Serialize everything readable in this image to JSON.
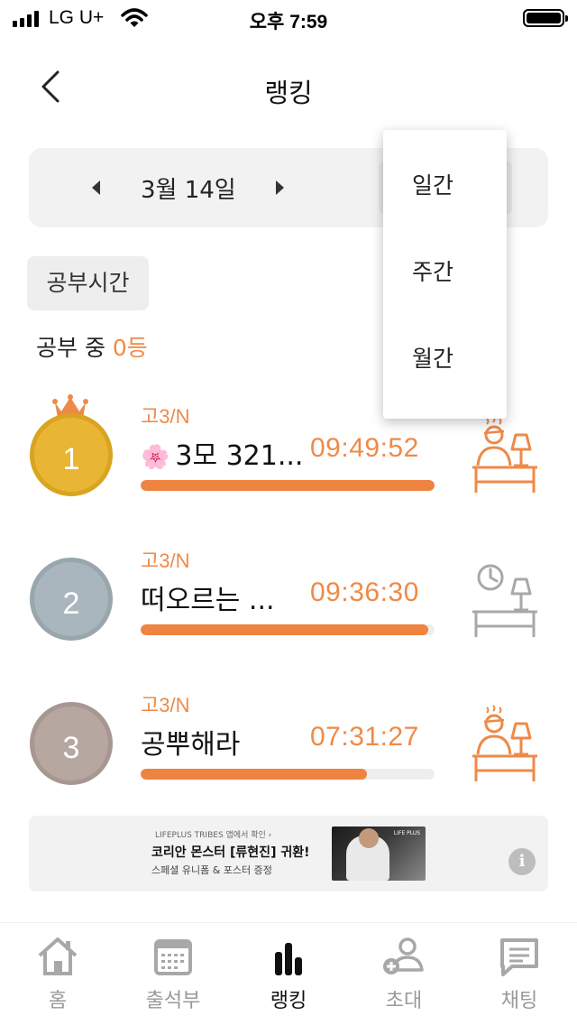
{
  "status_bar": {
    "carrier": "LG U+",
    "time": "오후 7:59"
  },
  "header": {
    "title": "랭킹"
  },
  "date_nav": {
    "date": "3월 14일"
  },
  "category": {
    "label": "공부시간"
  },
  "studying": {
    "prefix": "공부 중 ",
    "count": "0등"
  },
  "rankings": [
    {
      "rank": "1",
      "grade": "고3/N",
      "flower": "🌸",
      "name": "3모 321...",
      "time": "09:49:52",
      "progress": 1.0,
      "medal_color": "#e8b634",
      "status": "studying",
      "status_color": "#ee8a48",
      "crown": true
    },
    {
      "rank": "2",
      "grade": "고3/N",
      "flower": "",
      "name": "떠오르는  ...",
      "time": "09:36:30",
      "progress": 0.98,
      "medal_color": "#a9b6bd",
      "status": "away",
      "status_color": "#a8a8a8",
      "crown": false
    },
    {
      "rank": "3",
      "grade": "고3/N",
      "flower": "",
      "name": "공뿌해라",
      "time": "07:31:27",
      "progress": 0.77,
      "medal_color": "#b6a7a0",
      "status": "studying",
      "status_color": "#ee8a48",
      "crown": false
    }
  ],
  "ad": {
    "small_text": "LIFEPLUS TRIBES 앱에서 확인 ›",
    "main_text": "코리안 몬스터 [류현진] 귀환!",
    "sub_text": "스페셜 유니폼 & 포스터 증정",
    "logo_text": "LIFE PLUS",
    "icon": "info-icon"
  },
  "bottom_nav": [
    {
      "label": "홈",
      "icon": "home-icon",
      "active": false
    },
    {
      "label": "출석부",
      "icon": "calendar-icon",
      "active": false
    },
    {
      "label": "랭킹",
      "icon": "bar-chart-icon",
      "active": true
    },
    {
      "label": "초대",
      "icon": "add-user-icon",
      "active": false
    },
    {
      "label": "채팅",
      "icon": "chat-icon",
      "active": false
    }
  ],
  "dropdown": {
    "options": [
      "일간",
      "주간",
      "월간"
    ]
  },
  "colors": {
    "accent": "#ee8a48",
    "inactive": "#999999",
    "panel": "#f2f2f2"
  }
}
